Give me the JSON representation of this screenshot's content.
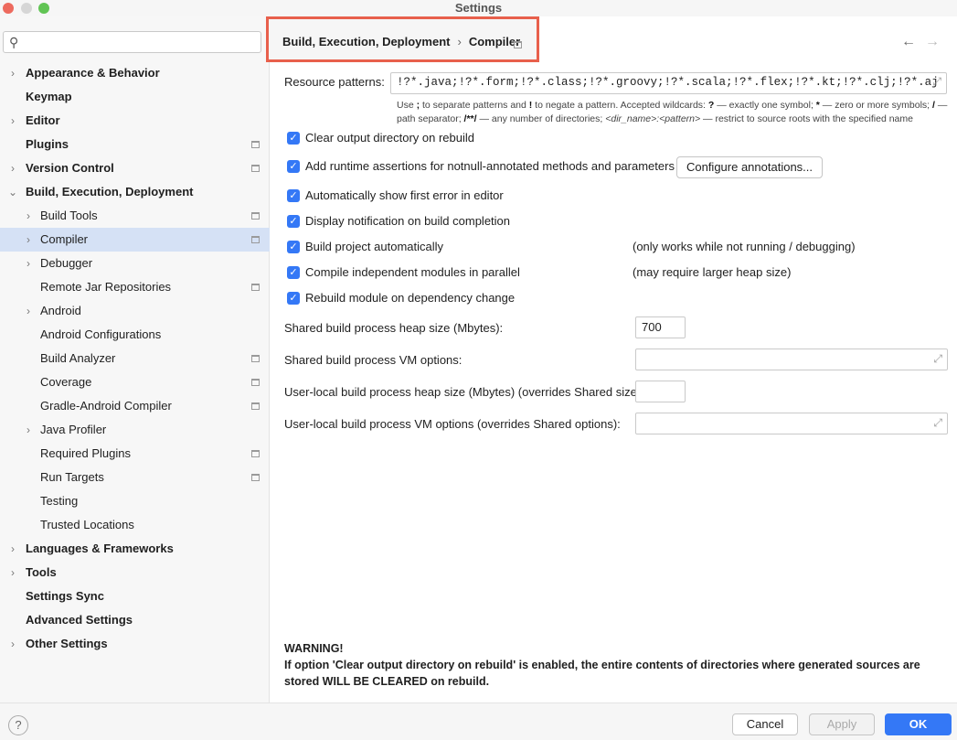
{
  "window": {
    "title": "Settings"
  },
  "search": {
    "placeholder": "",
    "value": ""
  },
  "sidebar": {
    "items": [
      {
        "label": "Appearance & Behavior",
        "level": 0,
        "chevron": true,
        "page_icon": false
      },
      {
        "label": "Keymap",
        "level": 0,
        "chevron": false,
        "page_icon": false
      },
      {
        "label": "Editor",
        "level": 0,
        "chevron": true,
        "page_icon": false
      },
      {
        "label": "Plugins",
        "level": 0,
        "chevron": false,
        "page_icon": true
      },
      {
        "label": "Version Control",
        "level": 0,
        "chevron": true,
        "page_icon": true
      },
      {
        "label": "Build, Execution, Deployment",
        "level": 0,
        "chevron": "open",
        "page_icon": false
      },
      {
        "label": "Build Tools",
        "level": 1,
        "chevron": true,
        "page_icon": true
      },
      {
        "label": "Compiler",
        "level": 1,
        "chevron": true,
        "page_icon": true,
        "selected": true
      },
      {
        "label": "Debugger",
        "level": 1,
        "chevron": true,
        "page_icon": false
      },
      {
        "label": "Remote Jar Repositories",
        "level": 1,
        "chevron": false,
        "page_icon": true
      },
      {
        "label": "Android",
        "level": 1,
        "chevron": true,
        "page_icon": false
      },
      {
        "label": "Android Configurations",
        "level": 1,
        "chevron": false,
        "page_icon": false
      },
      {
        "label": "Build Analyzer",
        "level": 1,
        "chevron": false,
        "page_icon": true
      },
      {
        "label": "Coverage",
        "level": 1,
        "chevron": false,
        "page_icon": true
      },
      {
        "label": "Gradle-Android Compiler",
        "level": 1,
        "chevron": false,
        "page_icon": true
      },
      {
        "label": "Java Profiler",
        "level": 1,
        "chevron": true,
        "page_icon": false
      },
      {
        "label": "Required Plugins",
        "level": 1,
        "chevron": false,
        "page_icon": true
      },
      {
        "label": "Run Targets",
        "level": 1,
        "chevron": false,
        "page_icon": true
      },
      {
        "label": "Testing",
        "level": 1,
        "chevron": false,
        "page_icon": false
      },
      {
        "label": "Trusted Locations",
        "level": 1,
        "chevron": false,
        "page_icon": false
      },
      {
        "label": "Languages & Frameworks",
        "level": 0,
        "chevron": true,
        "page_icon": false
      },
      {
        "label": "Tools",
        "level": 0,
        "chevron": true,
        "page_icon": false
      },
      {
        "label": "Settings Sync",
        "level": 0,
        "chevron": false,
        "page_icon": false
      },
      {
        "label": "Advanced Settings",
        "level": 0,
        "chevron": false,
        "page_icon": false
      },
      {
        "label": "Other Settings",
        "level": 0,
        "chevron": true,
        "page_icon": false
      }
    ]
  },
  "breadcrumb": {
    "parent": "Build, Execution, Deployment",
    "separator": "›",
    "current": "Compiler"
  },
  "resource_patterns": {
    "label": "Resource patterns:",
    "value": "!?*.java;!?*.form;!?*.class;!?*.groovy;!?*.scala;!?*.flex;!?*.kt;!?*.clj;!?*.aj"
  },
  "hint": {
    "line1_a": "Use ",
    "semicolon": ";",
    "line1_b": " to separate patterns and ",
    "bang": "!",
    "line1_c": " to negate a pattern. Accepted wildcards: ",
    "q": "?",
    "line1_d": " — exactly one symbol; ",
    "star": "*",
    "line1_e": " — zero or more symbols; ",
    "slash": "/",
    "line1_f": " —",
    "line2_a": "path separator; ",
    "dstar": "/**/",
    "line2_b": " — any number of directories; ",
    "dirname": "<dir_name>:<pattern>",
    "line2_c": " — restrict to source roots with the specified name"
  },
  "options": [
    {
      "label": "Clear output directory on rebuild",
      "checked": true
    },
    {
      "label": "Add runtime assertions for notnull-annotated methods and parameters",
      "checked": true
    },
    {
      "label": "Automatically show first error in editor",
      "checked": true
    },
    {
      "label": "Display notification on build completion",
      "checked": true
    },
    {
      "label": "Build project automatically",
      "checked": true,
      "note": "(only works while not running / debugging)"
    },
    {
      "label": "Compile independent modules in parallel",
      "checked": true,
      "note": "(may require larger heap size)"
    },
    {
      "label": "Rebuild module on dependency change",
      "checked": true
    }
  ],
  "configure_annotations_label": "Configure annotations...",
  "fields": {
    "shared_heap": {
      "label": "Shared build process heap size (Mbytes):",
      "value": "700"
    },
    "shared_vm": {
      "label": "Shared build process VM options:",
      "value": ""
    },
    "local_heap": {
      "label": "User-local build process heap size (Mbytes) (overrides Shared size):",
      "value": ""
    },
    "local_vm": {
      "label": "User-local build process VM options (overrides Shared options):",
      "value": ""
    }
  },
  "warning": {
    "title": "WARNING!",
    "body": "If option 'Clear output directory on rebuild' is enabled, the entire contents of directories where generated sources are stored WILL BE CLEARED on rebuild."
  },
  "footer": {
    "help": "?",
    "cancel": "Cancel",
    "apply": "Apply",
    "ok": "OK"
  },
  "nav": {
    "back": "←",
    "forward": "→"
  },
  "colors": {
    "accent": "#3478f6",
    "highlight_box": "#e8604c",
    "selection": "#d5e1f5"
  }
}
